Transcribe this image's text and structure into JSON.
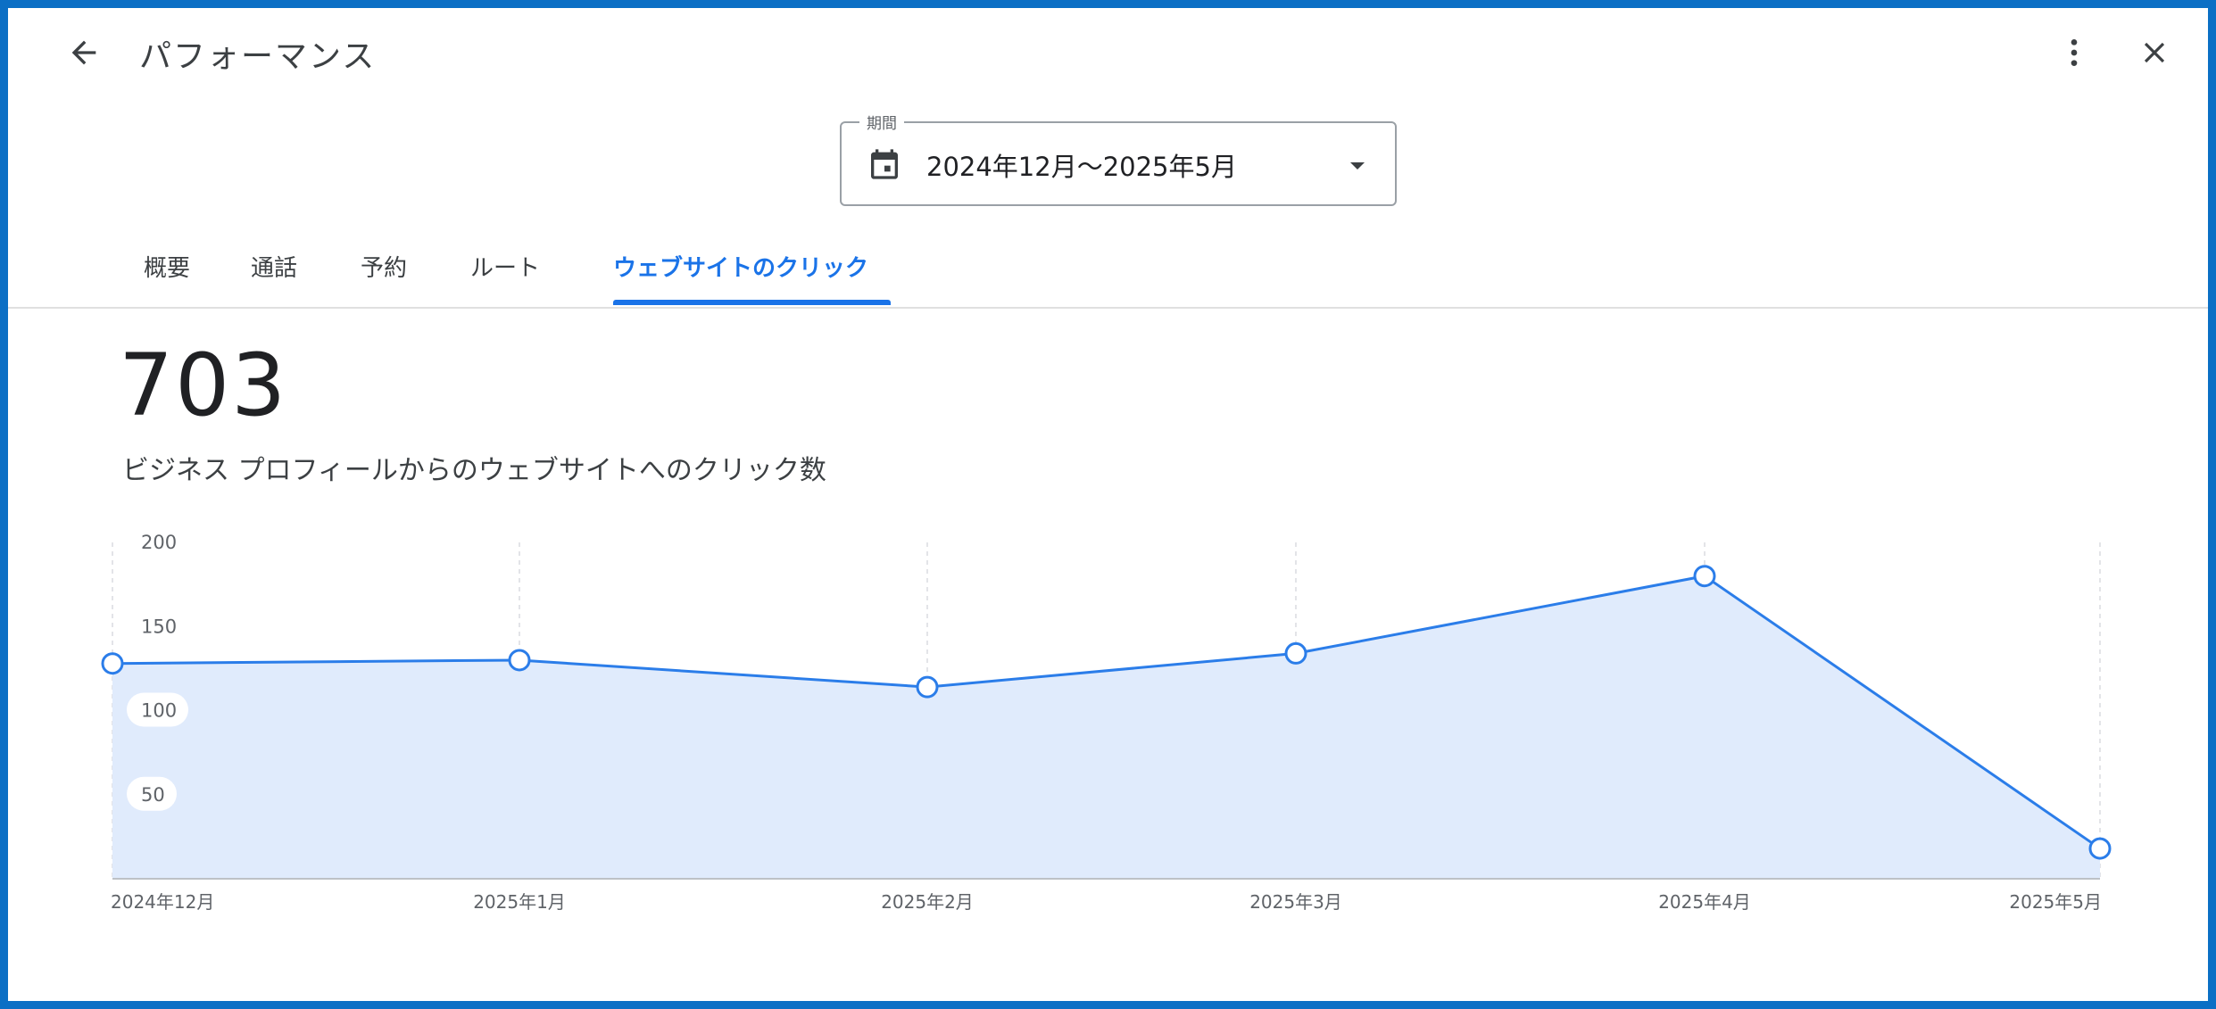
{
  "header": {
    "title": "パフォーマンス"
  },
  "period": {
    "label": "期間",
    "value": "2024年12月～2025年5月"
  },
  "tabs": [
    {
      "label": "概要",
      "active": false
    },
    {
      "label": "通話",
      "active": false
    },
    {
      "label": "予約",
      "active": false
    },
    {
      "label": "ルート",
      "active": false
    },
    {
      "label": "ウェブサイトのクリック",
      "active": true
    }
  ],
  "metric": {
    "value": "703",
    "label": "ビジネス プロフィールからのウェブサイトへのクリック数"
  },
  "icons": {
    "back": "arrow-back-icon",
    "more": "more-vert-icon",
    "close": "close-icon",
    "calendar": "calendar-icon",
    "dropdown": "arrow-drop-down-icon"
  },
  "colors": {
    "accent": "#1a73e8",
    "frame": "#0b6fc5",
    "area_fill": "#e0ebfc",
    "line": "#2b7de9"
  },
  "chart_data": {
    "type": "area",
    "categories": [
      "2024年12月",
      "2025年1月",
      "2025年2月",
      "2025年3月",
      "2025年4月",
      "2025年5月"
    ],
    "values": [
      128,
      130,
      114,
      134,
      180,
      18
    ],
    "ylim": [
      0,
      200
    ],
    "yticks": [
      50,
      100,
      150,
      200
    ],
    "grid": true
  }
}
